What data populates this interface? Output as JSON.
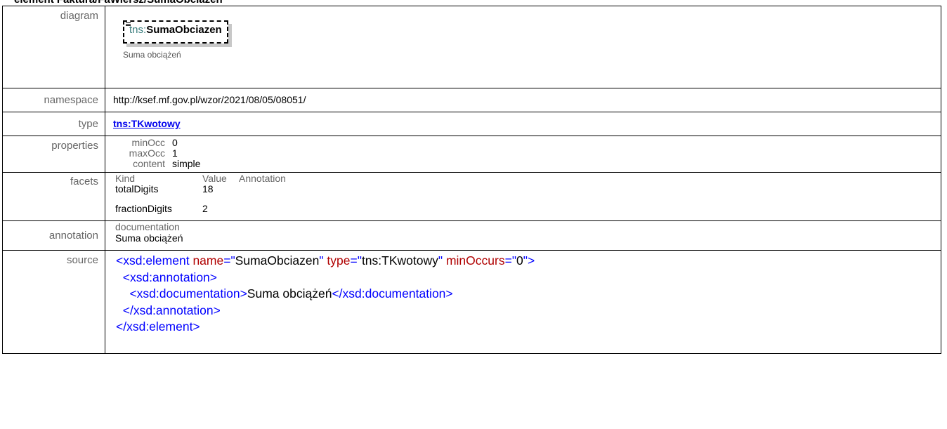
{
  "heading": "element Faktura/FaWiersz/SumaObciazen",
  "rows": {
    "diagram": {
      "label": "diagram",
      "prefix": "tns:",
      "name": "SumaObciazen",
      "documentation": "Suma obciążeń"
    },
    "namespace": {
      "label": "namespace",
      "value": "http://ksef.mf.gov.pl/wzor/2021/08/05/08051/"
    },
    "type": {
      "label": "type",
      "value": "tns:TKwotowy"
    },
    "properties": {
      "label": "properties",
      "items": [
        {
          "key": "minOcc",
          "value": "0"
        },
        {
          "key": "maxOcc",
          "value": "1"
        },
        {
          "key": "content",
          "value": "simple"
        }
      ]
    },
    "facets": {
      "label": "facets",
      "headers": [
        "Kind",
        "Value",
        "Annotation"
      ],
      "items": [
        {
          "kind": "totalDigits",
          "value": "18",
          "annotation": ""
        },
        {
          "kind": "fractionDigits",
          "value": "2",
          "annotation": ""
        }
      ]
    },
    "annotation": {
      "label": "annotation",
      "header": "documentation",
      "text": "Suma obciążeń"
    },
    "source": {
      "label": "source",
      "line1": {
        "open": "<xsd:element",
        "a1": "name",
        "eq": "=\"",
        "v1": "SumaObciazen",
        "q": "\"",
        "a2": "type",
        "v2": "tns:TKwotowy",
        "a3": "minOccurs",
        "v3": "0",
        "close": ">"
      },
      "line2": "<xsd:annotation>",
      "line3_open": "<xsd:documentation>",
      "line3_text": "Suma obciążeń",
      "line3_close": "</xsd:documentation>",
      "line4": "</xsd:annotation>",
      "line5": "</xsd:element>"
    }
  },
  "colors": {
    "tag": "#0000ff",
    "attribute": "#b00000",
    "label": "#666666",
    "link": "#0000ee"
  }
}
